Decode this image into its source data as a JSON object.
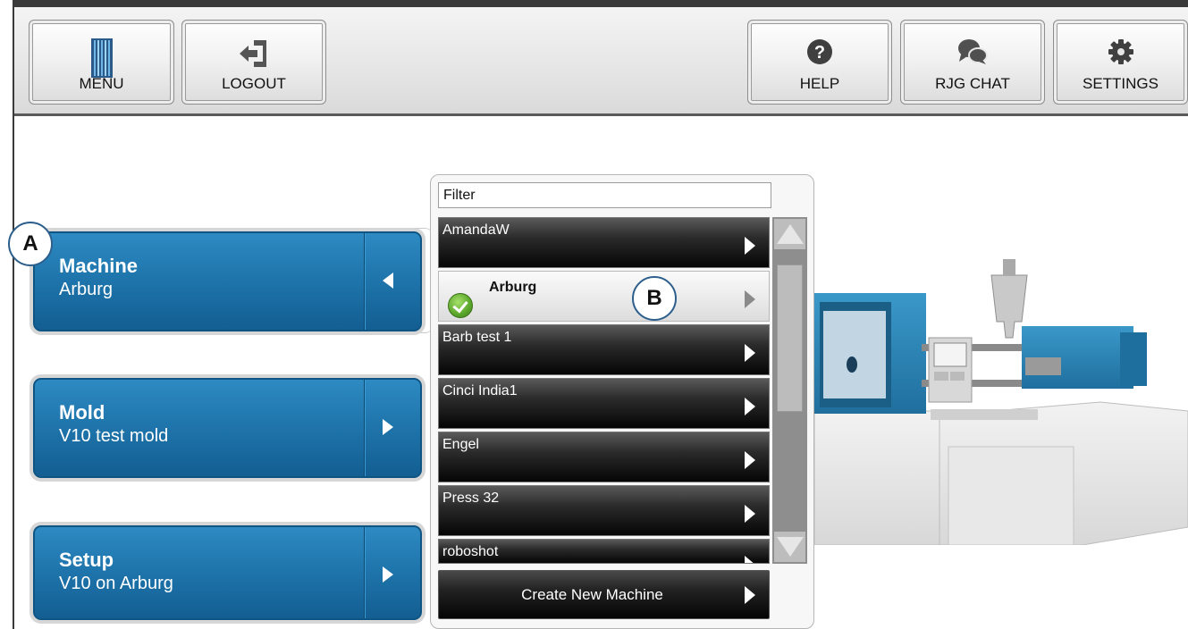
{
  "toolbar": {
    "menu_label": "MENU",
    "logout_label": "LOGOUT",
    "help_label": "HELP",
    "chat_label": "RJG CHAT",
    "settings_label": "SETTINGS",
    "icons": [
      "menu-logo-icon",
      "logout-icon",
      "help-icon",
      "chat-icon",
      "gear-icon"
    ]
  },
  "annotations": {
    "a": "A",
    "b": "B"
  },
  "panels": {
    "machine": {
      "title": "Machine",
      "value": "Arburg",
      "expanded": true
    },
    "mold": {
      "title": "Mold",
      "value": "V10 test mold"
    },
    "setup": {
      "title": "Setup",
      "value": "V10 on Arburg"
    }
  },
  "dropdown": {
    "filter_placeholder": "Filter",
    "items": [
      {
        "label": "AmandaW",
        "selected": false
      },
      {
        "label": "Arburg",
        "selected": true
      },
      {
        "label": "Barb test 1",
        "selected": false
      },
      {
        "label": "Cinci India1",
        "selected": false
      },
      {
        "label": "Engel",
        "selected": false
      },
      {
        "label": "Press 32",
        "selected": false
      },
      {
        "label": "roboshot",
        "selected": false
      }
    ],
    "create_label": "Create New Machine"
  },
  "colors": {
    "panel_blue": "#1f76ad",
    "list_black": "#050505",
    "check_green": "#5aa62a",
    "badge_border": "#2d5f8c"
  }
}
